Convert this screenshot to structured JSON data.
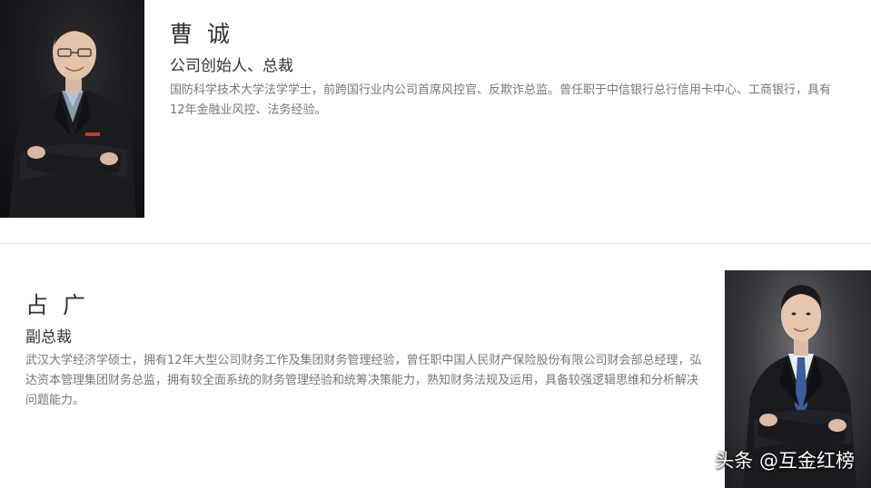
{
  "profiles": [
    {
      "name": "曹 诚",
      "title": "公司创始人、总裁",
      "bio": "国防科学技术大学法学学士，前跨国行业内公司首席风控官、反欺诈总监。曾任职于中信银行总行信用卡中心、工商银行，具有12年金融业风控、法务经验。"
    },
    {
      "name": "占 广",
      "title": "副总裁",
      "bio": "武汉大学经济学硕士，拥有12年大型公司财务工作及集团财务管理经验，曾任职中国人民财产保险股份有限公司财会部总经理，弘达资本管理集团财务总监，拥有较全面系统的财务管理经验和统筹决策能力，熟知财务法规及运用，具备较强逻辑思维和分析解决问题能力。"
    }
  ],
  "watermark": "头条 @互金红榜",
  "colors": {
    "name_text": "#333333",
    "bio_text": "#777777",
    "divider": "#e6e6e6",
    "background": "#ffffff"
  }
}
